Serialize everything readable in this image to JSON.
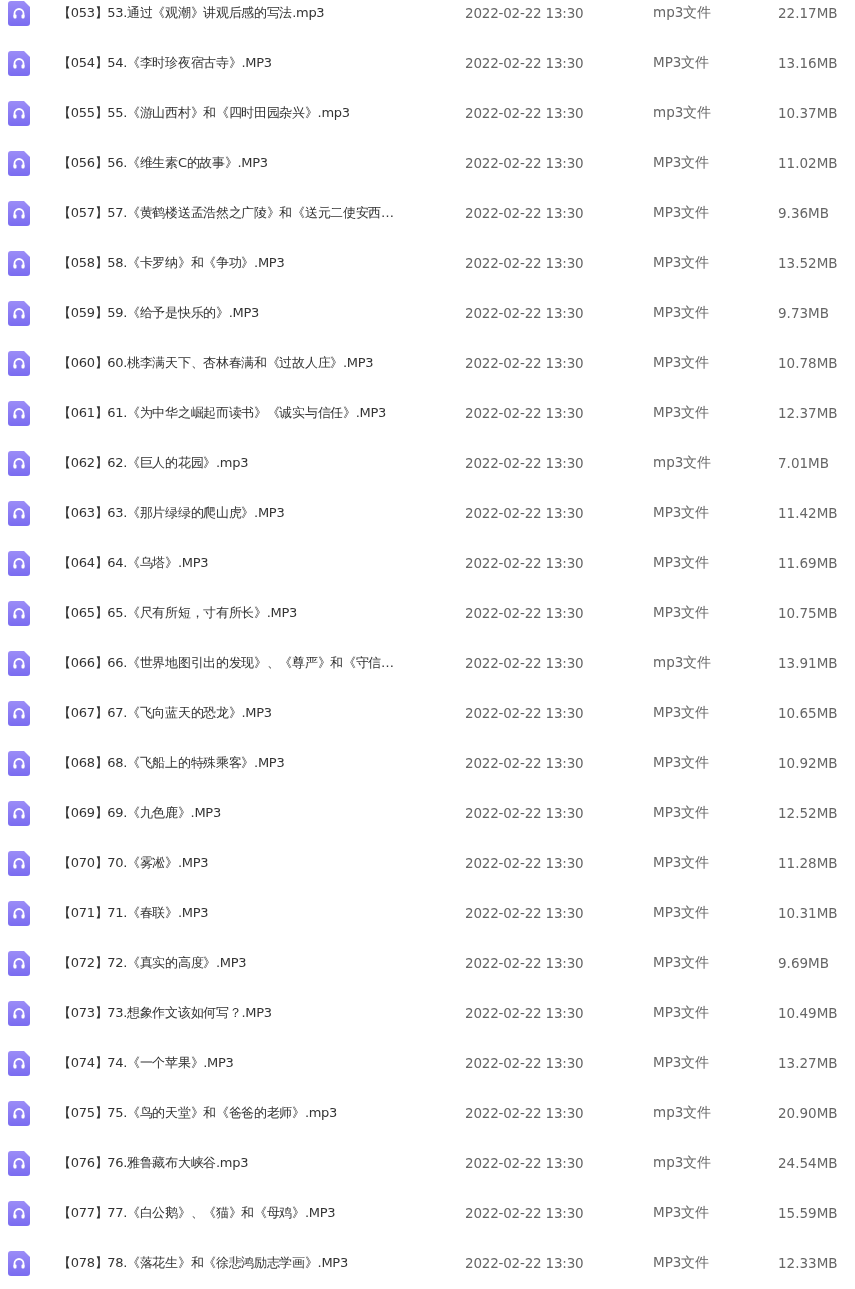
{
  "files": [
    {
      "name": "【053】53.通过《观潮》讲观后感的写法.mp3",
      "modified": "2022-02-22 13:30",
      "type": "mp3文件",
      "size": "22.17MB"
    },
    {
      "name": "【054】54.《李时珍夜宿古寺》.MP3",
      "modified": "2022-02-22 13:30",
      "type": "MP3文件",
      "size": "13.16MB"
    },
    {
      "name": "【055】55.《游山西村》和《四时田园杂兴》.mp3",
      "modified": "2022-02-22 13:30",
      "type": "mp3文件",
      "size": "10.37MB"
    },
    {
      "name": "【056】56.《维生素C的故事》.MP3",
      "modified": "2022-02-22 13:30",
      "type": "MP3文件",
      "size": "11.02MB"
    },
    {
      "name": "【057】57.《黄鹤楼送孟浩然之广陵》和《送元二使安西…",
      "modified": "2022-02-22 13:30",
      "type": "MP3文件",
      "size": "9.36MB"
    },
    {
      "name": "【058】58.《卡罗纳》和《争功》.MP3",
      "modified": "2022-02-22 13:30",
      "type": "MP3文件",
      "size": "13.52MB"
    },
    {
      "name": "【059】59.《给予是快乐的》.MP3",
      "modified": "2022-02-22 13:30",
      "type": "MP3文件",
      "size": "9.73MB"
    },
    {
      "name": "【060】60.桃李满天下、杏林春满和《过故人庄》.MP3",
      "modified": "2022-02-22 13:30",
      "type": "MP3文件",
      "size": "10.78MB"
    },
    {
      "name": "【061】61.《为中华之崛起而读书》《诚实与信任》.MP3",
      "modified": "2022-02-22 13:30",
      "type": "MP3文件",
      "size": "12.37MB"
    },
    {
      "name": "【062】62.《巨人的花园》.mp3",
      "modified": "2022-02-22 13:30",
      "type": "mp3文件",
      "size": "7.01MB"
    },
    {
      "name": "【063】63.《那片绿绿的爬山虎》.MP3",
      "modified": "2022-02-22 13:30",
      "type": "MP3文件",
      "size": "11.42MB"
    },
    {
      "name": "【064】64.《乌塔》.MP3",
      "modified": "2022-02-22 13:30",
      "type": "MP3文件",
      "size": "11.69MB"
    },
    {
      "name": "【065】65.《尺有所短，寸有所长》.MP3",
      "modified": "2022-02-22 13:30",
      "type": "MP3文件",
      "size": "10.75MB"
    },
    {
      "name": "【066】66.《世界地图引出的发现》、《尊严》和《守信…",
      "modified": "2022-02-22 13:30",
      "type": "mp3文件",
      "size": "13.91MB"
    },
    {
      "name": "【067】67.《飞向蓝天的恐龙》.MP3",
      "modified": "2022-02-22 13:30",
      "type": "MP3文件",
      "size": "10.65MB"
    },
    {
      "name": "【068】68.《飞船上的特殊乘客》.MP3",
      "modified": "2022-02-22 13:30",
      "type": "MP3文件",
      "size": "10.92MB"
    },
    {
      "name": "【069】69.《九色鹿》.MP3",
      "modified": "2022-02-22 13:30",
      "type": "MP3文件",
      "size": "12.52MB"
    },
    {
      "name": "【070】70.《雾凇》.MP3",
      "modified": "2022-02-22 13:30",
      "type": "MP3文件",
      "size": "11.28MB"
    },
    {
      "name": "【071】71.《春联》.MP3",
      "modified": "2022-02-22 13:30",
      "type": "MP3文件",
      "size": "10.31MB"
    },
    {
      "name": "【072】72.《真实的高度》.MP3",
      "modified": "2022-02-22 13:30",
      "type": "MP3文件",
      "size": "9.69MB"
    },
    {
      "name": "【073】73.想象作文该如何写？.MP3",
      "modified": "2022-02-22 13:30",
      "type": "MP3文件",
      "size": "10.49MB"
    },
    {
      "name": "【074】74.《一个苹果》.MP3",
      "modified": "2022-02-22 13:30",
      "type": "MP3文件",
      "size": "13.27MB"
    },
    {
      "name": "【075】75.《鸟的天堂》和《爸爸的老师》.mp3",
      "modified": "2022-02-22 13:30",
      "type": "mp3文件",
      "size": "20.90MB"
    },
    {
      "name": "【076】76.雅鲁藏布大峡谷.mp3",
      "modified": "2022-02-22 13:30",
      "type": "mp3文件",
      "size": "24.54MB"
    },
    {
      "name": "【077】77.《白公鹅》、《猫》和《母鸡》.MP3",
      "modified": "2022-02-22 13:30",
      "type": "MP3文件",
      "size": "15.59MB"
    },
    {
      "name": "【078】78.《落花生》和《徐悲鸿励志学画》.MP3",
      "modified": "2022-02-22 13:30",
      "type": "MP3文件",
      "size": "12.33MB"
    }
  ]
}
